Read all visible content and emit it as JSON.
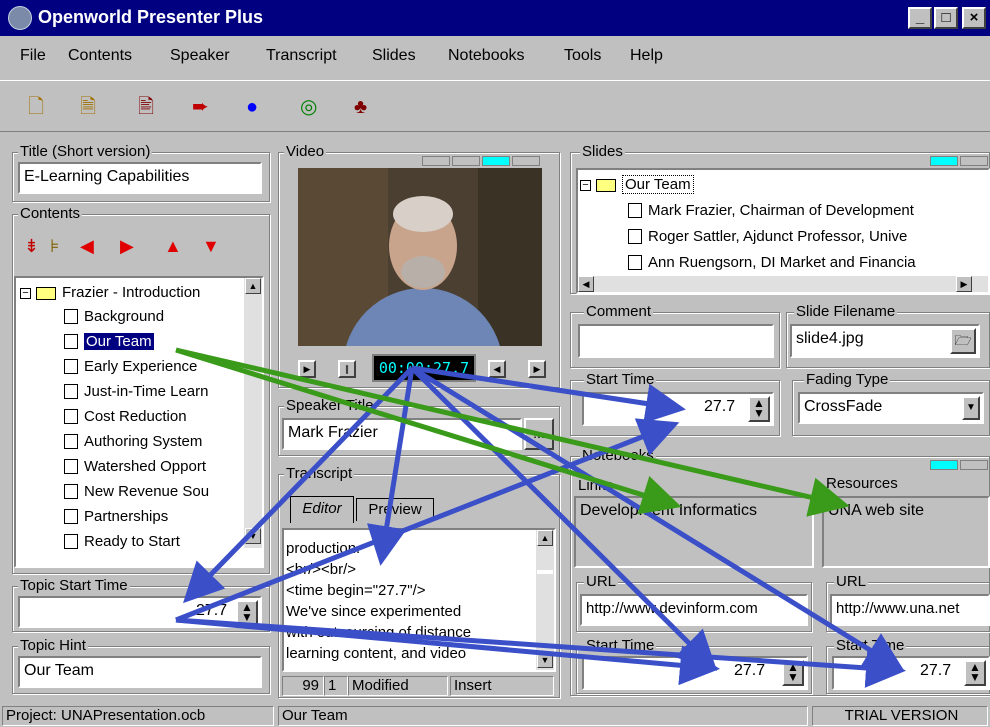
{
  "window": {
    "title": "Openworld Presenter Plus"
  },
  "menu": [
    "File",
    "Contents",
    "Speaker",
    "Transcript",
    "Slides",
    "Notebooks",
    "Tools",
    "Help"
  ],
  "toolbar": [
    "new-icon",
    "open-icon",
    "save-icon",
    "export-icon",
    "record-icon",
    "cd-icon",
    "people-icon"
  ],
  "title_group": {
    "label": "Title (Short version)",
    "value": "E-Learning Capabilities"
  },
  "contents": {
    "label": "Contents",
    "root": "Frazier - Introduction",
    "items": [
      "Background",
      "Our Team",
      "Early Experience",
      "Just-in-Time Learn",
      "Cost Reduction",
      "Authoring System",
      "Watershed Opport",
      "New Revenue Sou",
      "Partnerships",
      "Ready to Start"
    ],
    "selected": "Our Team"
  },
  "topic_start": {
    "label": "Topic Start Time",
    "value": "27.7"
  },
  "topic_hint": {
    "label": "Topic Hint",
    "value": "Our Team"
  },
  "video": {
    "label": "Video",
    "time": "00:00:27.7"
  },
  "speaker": {
    "label": "Speaker Title",
    "value": "Mark Frazier",
    "button": "..."
  },
  "transcript": {
    "label": "Transcript",
    "tabs": [
      "Editor",
      "Preview"
    ],
    "lines": [
      "production.",
      "<br/><br/>",
      "<time begin=\"27.7\"/>",
      "We've since experimented",
      "with outsourcing of distance",
      "learning content, and video"
    ],
    "status": {
      "line": "99",
      "col": "1",
      "state": "Modified",
      "mode": "Insert"
    }
  },
  "slides": {
    "label": "Slides",
    "root": "Our Team",
    "items": [
      "Mark Frazier, Chairman of Development",
      "Roger Sattler, Ajdunct Professor, Unive",
      "Ann Ruengsorn, DI Market and Financia"
    ]
  },
  "comment": {
    "label": "Comment",
    "value": ""
  },
  "slide_filename": {
    "label": "Slide Filename",
    "value": "slide4.jpg"
  },
  "slide_start": {
    "label": "Start Time",
    "value": "27.7"
  },
  "fading": {
    "label": "Fading Type",
    "value": "CrossFade"
  },
  "notebooks": {
    "label": "Notebooks",
    "links": {
      "label": "Links",
      "item": "Development Informatics",
      "url_label": "URL",
      "url": "http://www.devinform.com",
      "start_label": "Start Time",
      "start": "27.7"
    },
    "resources": {
      "label": "Resources",
      "item": "UNA web site",
      "url_label": "URL",
      "url": "http://www.una.net",
      "start_label": "Start Time",
      "start": "27.7"
    }
  },
  "status": {
    "project": "Project: UNAPresentation.ocb",
    "topic": "Our Team",
    "trial": "TRIAL VERSION"
  },
  "colors": {
    "titlebar": "#000080",
    "face": "#c0c0c0",
    "blue_arrow": "#3a4fc8",
    "green_arrow": "#3a9a1a"
  }
}
